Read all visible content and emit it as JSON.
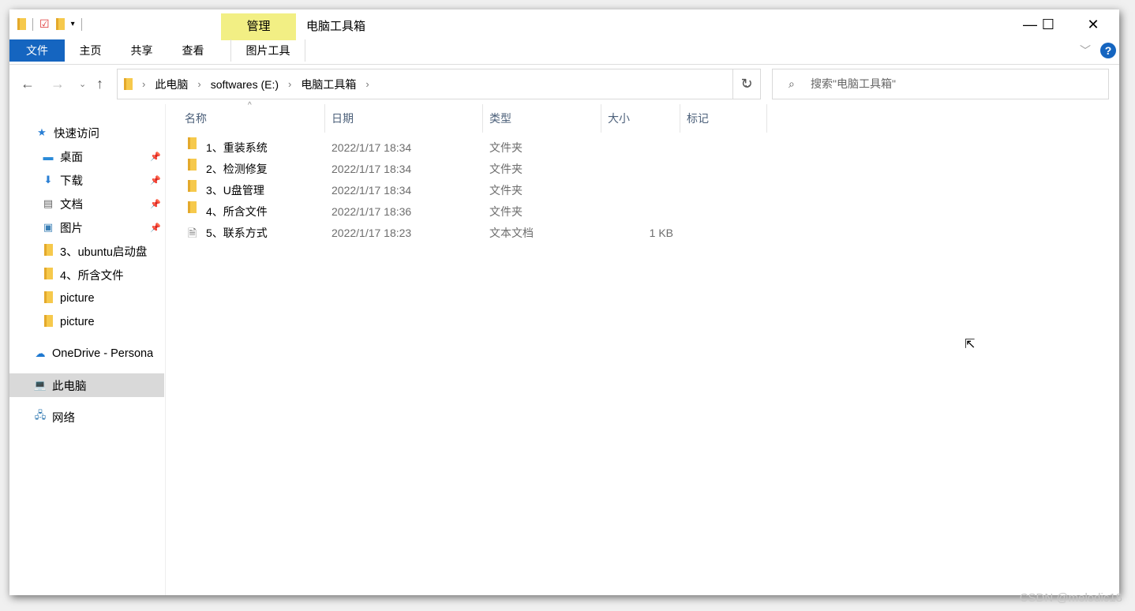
{
  "title": "电脑工具箱",
  "context_tab": "管理",
  "ribbon_tabs": [
    "文件",
    "主页",
    "共享",
    "查看",
    "图片工具"
  ],
  "breadcrumb": [
    "此电脑",
    "softwares (E:)",
    "电脑工具箱"
  ],
  "search_placeholder": "搜索\"电脑工具箱\"",
  "columns": [
    "名称",
    "日期",
    "类型",
    "大小",
    "标记"
  ],
  "files": [
    {
      "name": "1、重装系统",
      "date": "2022/1/17 18:34",
      "type": "文件夹",
      "size": "",
      "icon": "folder"
    },
    {
      "name": "2、检测修复",
      "date": "2022/1/17 18:34",
      "type": "文件夹",
      "size": "",
      "icon": "folder"
    },
    {
      "name": "3、U盘管理",
      "date": "2022/1/17 18:34",
      "type": "文件夹",
      "size": "",
      "icon": "folder"
    },
    {
      "name": "4、所含文件",
      "date": "2022/1/17 18:36",
      "type": "文件夹",
      "size": "",
      "icon": "folder"
    },
    {
      "name": "5、联系方式",
      "date": "2022/1/17 18:23",
      "type": "文本文档",
      "size": "1 KB",
      "icon": "text-file"
    }
  ],
  "nav": {
    "quick_access": "快速访问",
    "items": [
      "桌面",
      "下载",
      "文档",
      "图片",
      "3、ubuntu启动盘",
      "4、所含文件",
      "picture",
      "picture"
    ],
    "onedrive": "OneDrive - Persona",
    "this_pc": "此电脑",
    "network": "网络"
  },
  "watermark": "CSDN @melodic18"
}
